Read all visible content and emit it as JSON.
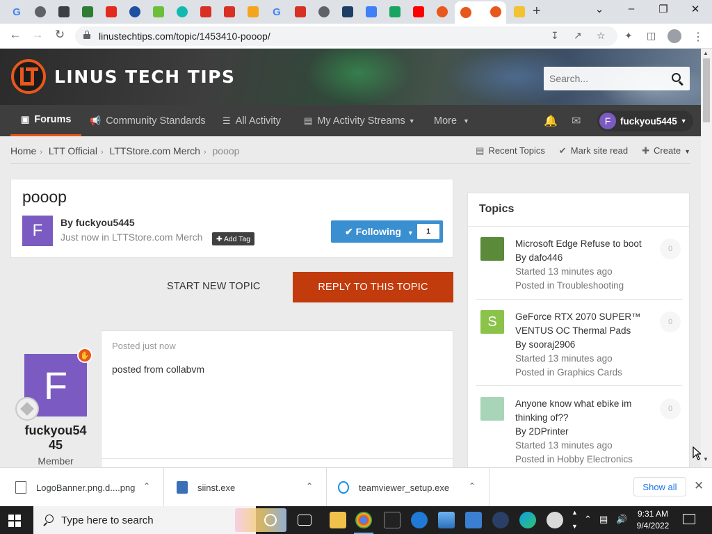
{
  "browser": {
    "tabs": [
      {
        "icon": "google-icon",
        "color": "#4285f4",
        "glyph": "G"
      },
      {
        "icon": "globe-icon",
        "color": "#5f6368",
        "glyph": ""
      },
      {
        "icon": "app-icon",
        "color": "#3c4043",
        "glyph": ""
      },
      {
        "icon": "doc-icon",
        "color": "#2e7d32",
        "glyph": ""
      },
      {
        "icon": "adobe-icon",
        "color": "#e32b1d",
        "glyph": ""
      },
      {
        "icon": "circle-icon",
        "color": "#1e4fa3",
        "glyph": ""
      },
      {
        "icon": "recycle-icon",
        "color": "#6bbf3b",
        "glyph": ""
      },
      {
        "icon": "ring-icon",
        "color": "#12b9b0",
        "glyph": ""
      },
      {
        "icon": "shield-icon",
        "color": "#d93025",
        "glyph": ""
      },
      {
        "icon": "shield-x-icon",
        "color": "#d93025",
        "glyph": ""
      },
      {
        "icon": "rainbow-icon",
        "color": "#f4a51c",
        "glyph": ""
      },
      {
        "icon": "google-icon",
        "color": "#4285f4",
        "glyph": "G"
      },
      {
        "icon": "shield-x-icon",
        "color": "#d93025",
        "glyph": ""
      },
      {
        "icon": "globe-icon",
        "color": "#5f6368",
        "glyph": ""
      },
      {
        "icon": "square-icon",
        "color": "#1d3f66",
        "glyph": ""
      },
      {
        "icon": "hex-icon",
        "color": "#3f7ff7",
        "glyph": ""
      },
      {
        "icon": "play-icon",
        "color": "#19a463",
        "glyph": ""
      },
      {
        "icon": "youtube-icon",
        "color": "#ff0000",
        "glyph": ""
      },
      {
        "icon": "ltt-icon",
        "color": "#e8571b",
        "glyph": ""
      },
      {
        "icon": "ltt-icon",
        "color": "#e8571b",
        "glyph": ""
      },
      {
        "icon": "ltt-icon",
        "color": "#e8571b",
        "glyph": ""
      },
      {
        "icon": "banana-icon",
        "color": "#f2c230",
        "glyph": ""
      }
    ],
    "url": "linustechtips.com/topic/1453410-pooop/"
  },
  "site": {
    "logo_text": "LINUS TECH TIPS",
    "search_placeholder": "Search..."
  },
  "nav": {
    "items": [
      {
        "label": "Forums",
        "icon": "comments-icon",
        "active": true
      },
      {
        "label": "Community Standards",
        "icon": "megaphone-icon",
        "active": false
      },
      {
        "label": "All Activity",
        "icon": "list-icon",
        "active": false
      },
      {
        "label": "My Activity Streams",
        "icon": "stream-icon",
        "active": false
      },
      {
        "label": "More",
        "icon": "",
        "active": false
      }
    ],
    "user_initial": "F",
    "username": "fuckyou5445"
  },
  "breadcrumb": {
    "items": [
      "Home",
      "LTT Official",
      "LTTStore.com Merch"
    ],
    "current": "pooop",
    "actions": {
      "recent_topics": "Recent Topics",
      "mark_read": "Mark site read",
      "create": "Create"
    }
  },
  "topic": {
    "title": "pooop",
    "author_initial": "F",
    "by_line": "By fuckyou5445",
    "meta_prefix": "Just now in",
    "forum": "LTTStore.com Merch",
    "add_tag": "Add Tag",
    "follow_label": "Following",
    "follow_count": "1",
    "start_new": "START NEW TOPIC",
    "reply": "REPLY TO THIS TOPIC"
  },
  "post": {
    "author_initial": "F",
    "author_line1": "fuckyou54",
    "author_line2": "45",
    "role": "Member",
    "time": "Posted just now",
    "content": "posted from collabvm"
  },
  "sidebar": {
    "title": "Topics",
    "topics": [
      {
        "title": "Microsoft Edge Refuse to boot",
        "by": "By dafo446",
        "started": "Started 13 minutes ago",
        "posted_prefix": "Posted in",
        "forum": "Troubleshooting",
        "count": "0",
        "thumb_color": "#5a8a3a"
      },
      {
        "title_line1": "GeForce RTX 2070 SUPER™",
        "title_line2": "VENTUS OC Thermal Pads",
        "by": "By sooraj2906",
        "started": "Started 13 minutes ago",
        "posted_prefix": "Posted in",
        "forum": "Graphics Cards",
        "count": "0",
        "thumb_color": "#8bc34a",
        "thumb_letter": "S"
      },
      {
        "title_line1": "Anyone know what ebike im",
        "title_line2": "thinking of??",
        "by": "By 2DPrinter",
        "started": "Started 13 minutes ago",
        "posted_prefix": "Posted in",
        "forum": "Hobby Electronics",
        "count": "0",
        "thumb_color": "#a8d5b8"
      }
    ]
  },
  "downloads": {
    "items": [
      {
        "name": "LogoBanner.png.d....png"
      },
      {
        "name": "siinst.exe"
      },
      {
        "name": "teamviewer_setup.exe"
      }
    ],
    "show_all": "Show all"
  },
  "taskbar": {
    "search_placeholder": "Type here to search",
    "time": "9:31 AM",
    "date": "9/4/2022"
  }
}
